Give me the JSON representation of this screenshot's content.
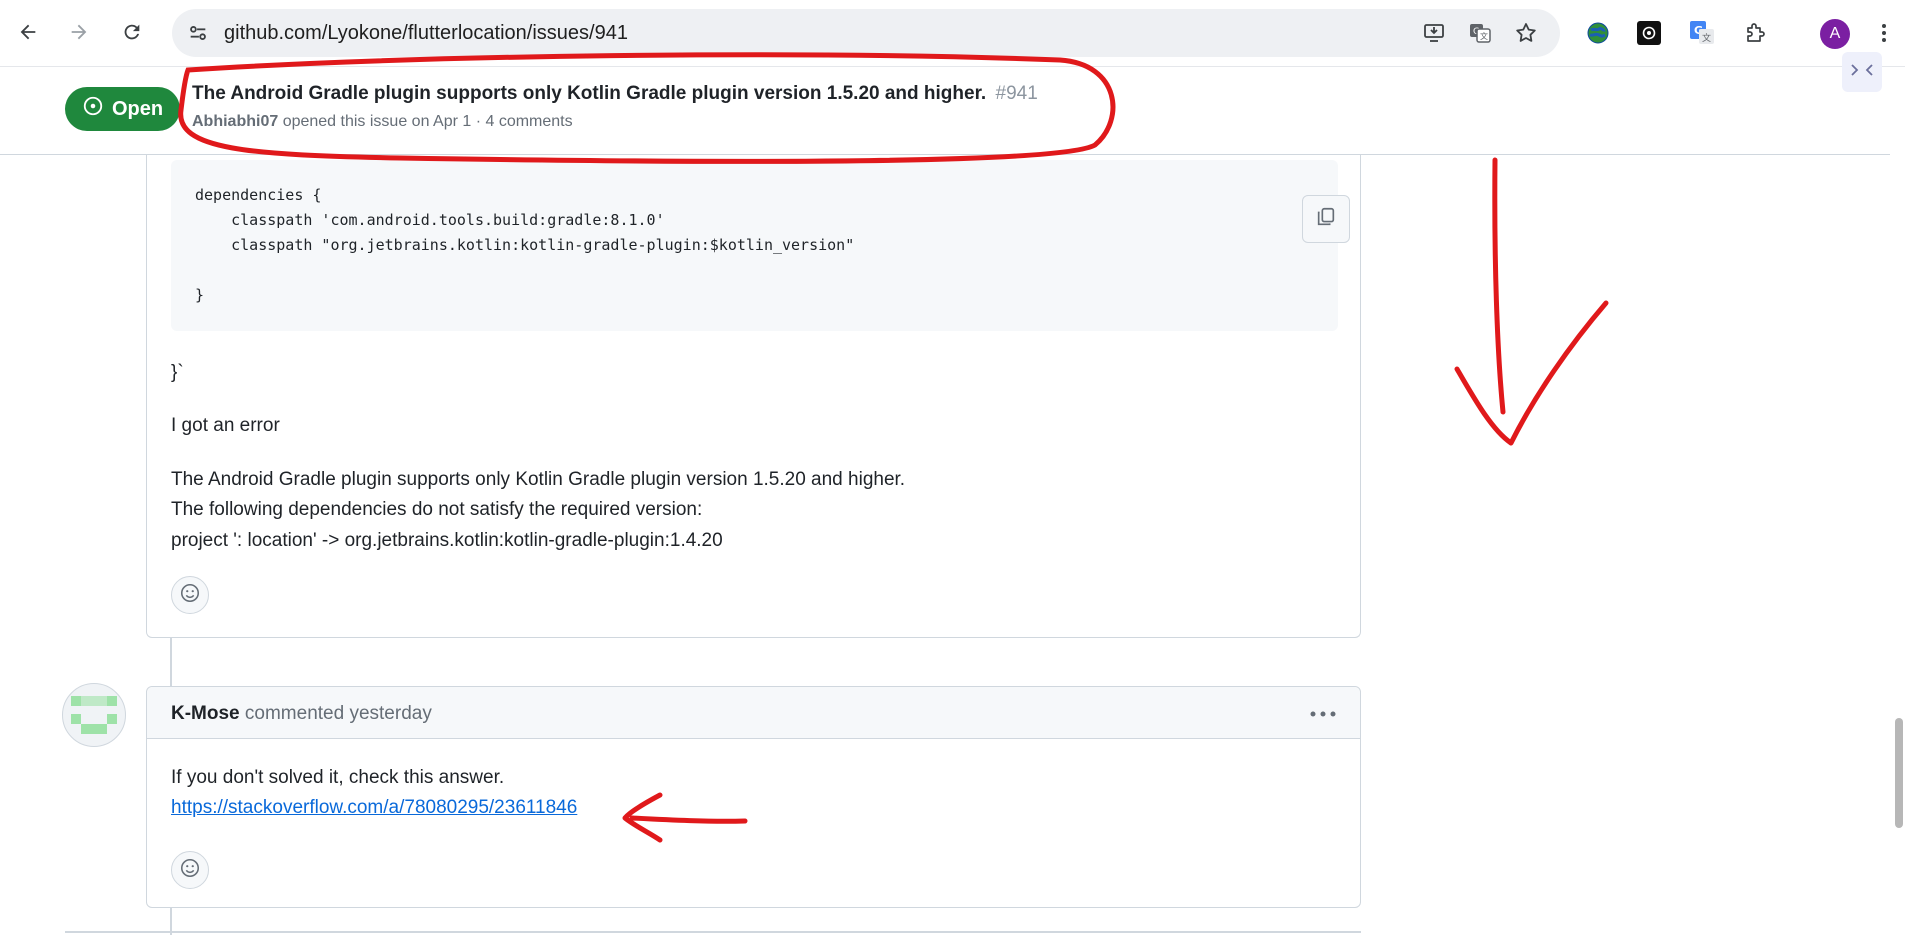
{
  "browser": {
    "url": "github.com/Lyokone/flutterlocation/issues/941",
    "profile_initial": "A",
    "colors": {
      "omnibox_bg": "#eef0f3",
      "profile_bg": "#7b1fa2"
    },
    "icons": [
      "back-arrow-icon",
      "forward-arrow-icon",
      "reload-icon",
      "site-settings-icon",
      "install-app-icon",
      "translate-icon",
      "bookmark-star-icon",
      "extension-globe-icon",
      "extension-chatgpt-icon",
      "extension-google-translate-icon",
      "extensions-puzzle-icon",
      "browser-menu-icon"
    ]
  },
  "issue": {
    "state": "Open",
    "title": "The Android Gradle plugin supports only Kotlin Gradle plugin version 1.5.20 and higher.",
    "number": "#941",
    "author": "Abhiabhi07",
    "meta_rest": "opened this issue on Apr 1 · 4 comments",
    "colors": {
      "open_badge": "#1f883d",
      "link": "#0969da"
    }
  },
  "first_comment": {
    "code_lines": [
      "dependencies {",
      "    classpath 'com.android.tools.build:gradle:8.1.0'",
      "    classpath \"org.jetbrains.kotlin:kotlin-gradle-plugin:$kotlin_version\"",
      "",
      "}"
    ],
    "after_code": "}`",
    "paragraph_1": "I got an error",
    "error_lines": [
      "The Android Gradle plugin supports only Kotlin Gradle plugin version 1.5.20 and higher.",
      "The following dependencies do not satisfy the required version:",
      "project ': location' -> org.jetbrains.kotlin:kotlin-gradle-plugin:1.4.20"
    ]
  },
  "second_comment": {
    "author": "K-Mose",
    "action": "commented yesterday",
    "text": "If you don't solved it, check this answer.",
    "link": "https://stackoverflow.com/a/78080295/23611846"
  },
  "annotation_color": "#e0191b"
}
